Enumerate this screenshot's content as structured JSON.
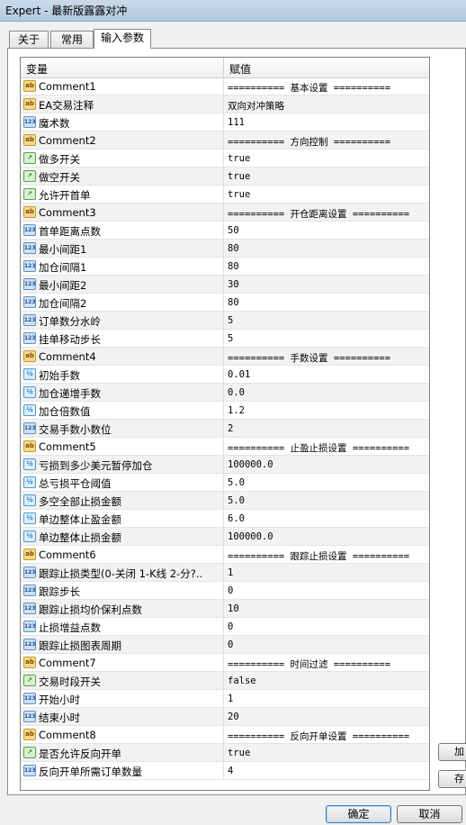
{
  "window": {
    "title": "Expert - 最新版露露对冲"
  },
  "tabs": [
    {
      "label": "关于"
    },
    {
      "label": "常用"
    },
    {
      "label": "输入参数"
    }
  ],
  "grid": {
    "col_variable": "变量",
    "col_value": "赋值",
    "rows": [
      {
        "icon": "string-type-icon",
        "name": "Comment1",
        "value": "========== 基本设置 =========="
      },
      {
        "icon": "string-type-icon",
        "name": "EA交易注释",
        "value": "双向对冲策略"
      },
      {
        "icon": "integer-type-icon",
        "name": "魔术数",
        "value": "111"
      },
      {
        "icon": "string-type-icon",
        "name": "Comment2",
        "value": "========== 方向控制 =========="
      },
      {
        "icon": "bool-type-icon",
        "name": "做多开关",
        "value": "true"
      },
      {
        "icon": "bool-type-icon",
        "name": "做空开关",
        "value": "true"
      },
      {
        "icon": "bool-type-icon",
        "name": "允许开首单",
        "value": "true"
      },
      {
        "icon": "string-type-icon",
        "name": "Comment3",
        "value": "========== 开仓距离设置 =========="
      },
      {
        "icon": "integer-type-icon",
        "name": "首单距离点数",
        "value": "50"
      },
      {
        "icon": "integer-type-icon",
        "name": "最小间距1",
        "value": "80"
      },
      {
        "icon": "integer-type-icon",
        "name": "加仓间隔1",
        "value": "80"
      },
      {
        "icon": "integer-type-icon",
        "name": "最小间距2",
        "value": "30"
      },
      {
        "icon": "integer-type-icon",
        "name": "加仓间隔2",
        "value": "80"
      },
      {
        "icon": "integer-type-icon",
        "name": "订单数分水岭",
        "value": "5"
      },
      {
        "icon": "integer-type-icon",
        "name": "挂单移动步长",
        "value": "5"
      },
      {
        "icon": "string-type-icon",
        "name": "Comment4",
        "value": "========== 手数设置 =========="
      },
      {
        "icon": "double-type-icon",
        "name": "初始手数",
        "value": "0.01"
      },
      {
        "icon": "double-type-icon",
        "name": "加仓递增手数",
        "value": "0.0"
      },
      {
        "icon": "double-type-icon",
        "name": "加仓倍数值",
        "value": "1.2"
      },
      {
        "icon": "integer-type-icon",
        "name": "交易手数小数位",
        "value": "2"
      },
      {
        "icon": "string-type-icon",
        "name": "Comment5",
        "value": "========== 止盈止损设置 =========="
      },
      {
        "icon": "double-type-icon",
        "name": "亏损到多少美元暂停加仓",
        "value": "100000.0"
      },
      {
        "icon": "double-type-icon",
        "name": "总亏损平仓阈值",
        "value": "5.0"
      },
      {
        "icon": "double-type-icon",
        "name": "多空全部止损金额",
        "value": "5.0"
      },
      {
        "icon": "double-type-icon",
        "name": "单边整体止盈金额",
        "value": "6.0"
      },
      {
        "icon": "double-type-icon",
        "name": "单边整体止损金额",
        "value": "100000.0"
      },
      {
        "icon": "string-type-icon",
        "name": "Comment6",
        "value": "========== 跟踪止损设置 =========="
      },
      {
        "icon": "integer-type-icon",
        "name": "跟踪止损类型(0-关闭 1-K线 2-分?..",
        "value": "1"
      },
      {
        "icon": "integer-type-icon",
        "name": "跟踪步长",
        "value": "0"
      },
      {
        "icon": "integer-type-icon",
        "name": "跟踪止损均价保利点数",
        "value": "10"
      },
      {
        "icon": "integer-type-icon",
        "name": "止损增益点数",
        "value": "0"
      },
      {
        "icon": "integer-type-icon",
        "name": "跟踪止损图表周期",
        "value": "0"
      },
      {
        "icon": "string-type-icon",
        "name": "Comment7",
        "value": "========== 时间过滤 =========="
      },
      {
        "icon": "bool-type-icon",
        "name": "交易时段开关",
        "value": "false"
      },
      {
        "icon": "integer-type-icon",
        "name": "开始小时",
        "value": "1"
      },
      {
        "icon": "integer-type-icon",
        "name": "结束小时",
        "value": "20"
      },
      {
        "icon": "string-type-icon",
        "name": "Comment8",
        "value": "========== 反向开单设置 =========="
      },
      {
        "icon": "bool-type-icon",
        "name": "是否允许反向开单",
        "value": "true"
      },
      {
        "icon": "integer-type-icon",
        "name": "反向开单所需订单数量",
        "value": "4"
      }
    ]
  },
  "side_buttons": [
    {
      "label": "加"
    },
    {
      "label": "存"
    }
  ],
  "buttons": {
    "ok": "确定",
    "cancel": "取消"
  },
  "icon_glyphs": {
    "string-type-icon": "ab",
    "integer-type-icon": "123",
    "bool-type-icon": "↗",
    "double-type-icon": "½"
  },
  "colors": {
    "titlebar": "#b3c9e0",
    "row_alt": "#f2f2f2",
    "default_button_border": "#3c7fb1"
  }
}
